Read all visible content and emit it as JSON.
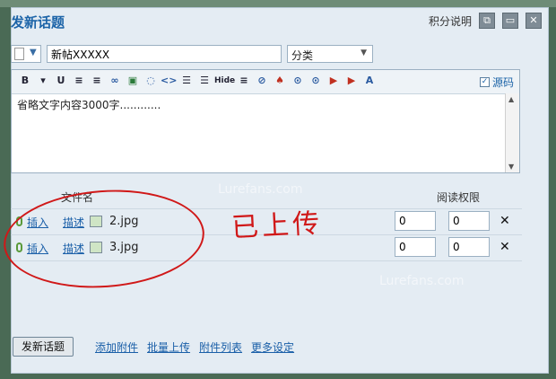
{
  "dialog": {
    "title": "发新话题",
    "points_link": "积分说明"
  },
  "form": {
    "type_icon": "document-icon",
    "subject_value": "新帖XXXXX",
    "category_selected": "分类"
  },
  "editor": {
    "source_label": "源码",
    "source_checked": true,
    "content": "省略文字内容3000字............",
    "tool_glyphs": [
      "B",
      "▾",
      "U",
      "≡",
      "≡",
      "∞",
      "▣",
      "◌",
      "<>",
      "☰",
      "☰",
      "Hide",
      "≡",
      "⊘",
      "♠",
      "⊙",
      "⊙",
      "▶",
      "▶",
      "A"
    ]
  },
  "attachments": {
    "col_filename": "文件名",
    "col_permission": "阅读权限",
    "rows": [
      {
        "insert": "插入",
        "describe": "描述",
        "filename": "2.jpg",
        "value1": "0",
        "value2": "0"
      },
      {
        "insert": "插入",
        "describe": "描述",
        "filename": "3.jpg",
        "value1": "0",
        "value2": "0"
      }
    ]
  },
  "annotation": {
    "handwritten": "已上传",
    "color": "#d01818"
  },
  "watermarks": [
    "Lurefans.com",
    "Lurefans.com"
  ],
  "footer": {
    "post_button": "发新话题",
    "links": [
      "添加附件",
      "批量上传",
      "附件列表",
      "更多设定"
    ]
  },
  "colors": {
    "accent": "#1c64a8",
    "dialog_bg": "#e4ecf3"
  }
}
